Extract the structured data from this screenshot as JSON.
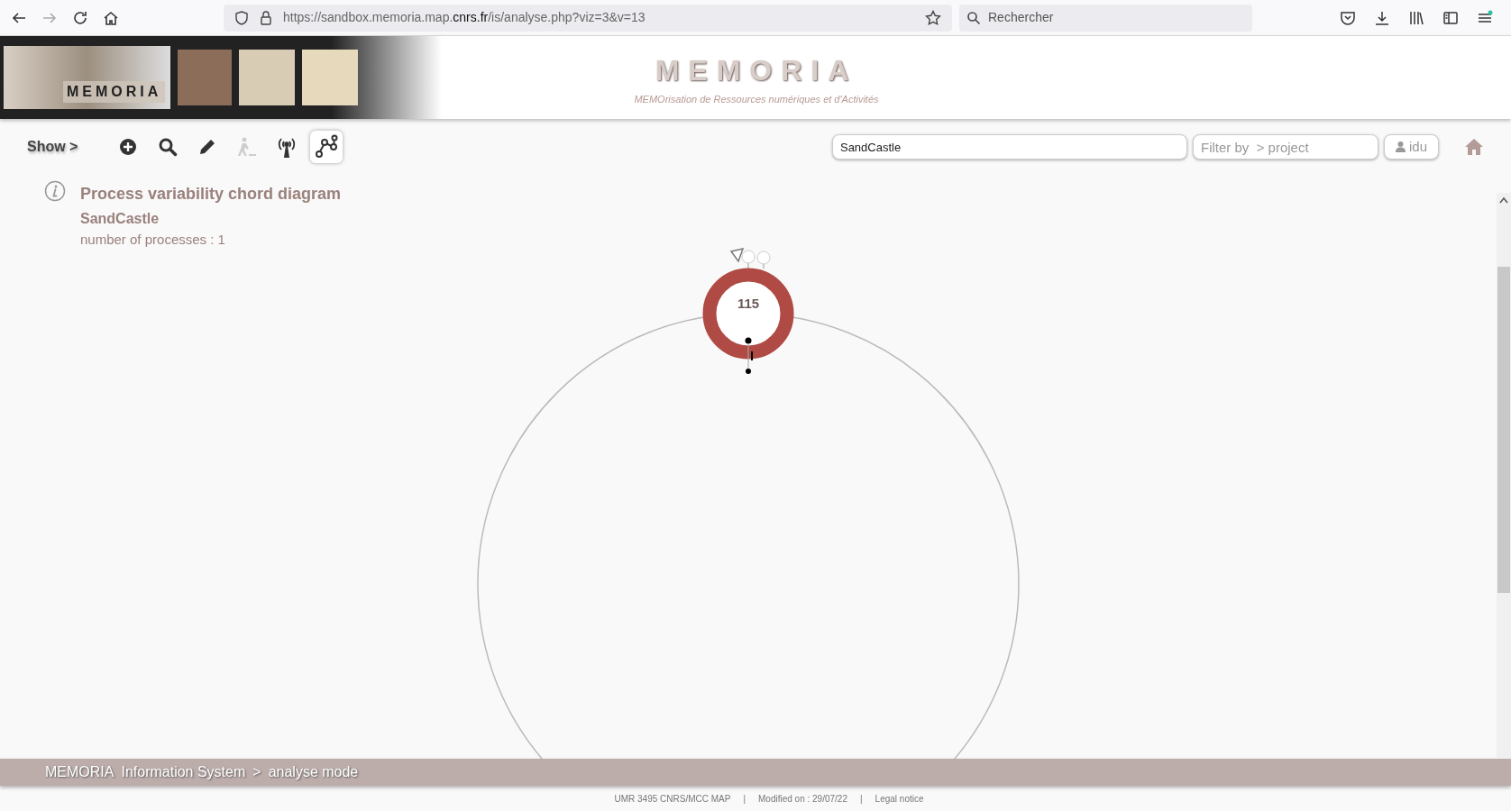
{
  "browser": {
    "url_prefix": "https://sandbox.memoria.map.",
    "url_domain": "cnrs.fr",
    "url_suffix": "/is/analyse.php?viz=3&v=13",
    "search_placeholder": "Rechercher"
  },
  "header": {
    "banner_label": "MEMORIA",
    "title": "MEMORIA",
    "subtitle": "MEMOrisation de Ressources numériques et d'Activités"
  },
  "toolbar": {
    "show_label": "Show >",
    "tools": [
      {
        "kind": "add",
        "disabled": false,
        "selected": false
      },
      {
        "kind": "search",
        "disabled": false,
        "selected": false
      },
      {
        "kind": "edit",
        "disabled": false,
        "selected": false
      },
      {
        "kind": "worker",
        "disabled": true,
        "selected": false
      },
      {
        "kind": "antenna",
        "disabled": false,
        "selected": false
      },
      {
        "kind": "graph",
        "disabled": false,
        "selected": true
      }
    ],
    "search_value": "SandCastle",
    "filter_placeholder": "Filter by  > project",
    "user": "idu"
  },
  "info": {
    "title": "Process variability chord diagram",
    "subtitle": "SandCastle",
    "count": "number of processes : 1"
  },
  "diagram": {
    "node_label": "115"
  },
  "breadcrumb": [
    "MEMORIA",
    "Information System",
    ">",
    "analyse mode"
  ],
  "footer": [
    "UMR 3495 CNRS/MCC MAP",
    "|",
    "Modified on : 29/07/22",
    "|",
    "Legal notice"
  ]
}
